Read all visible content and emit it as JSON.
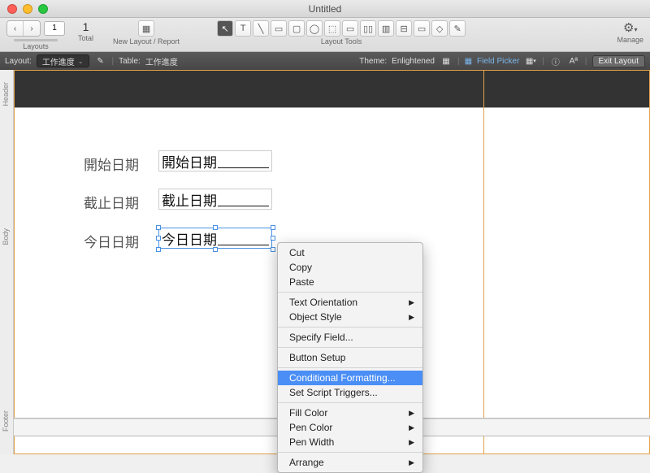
{
  "window": {
    "title": "Untitled"
  },
  "toolbar": {
    "page_current": "1",
    "total_count": "1",
    "total_label": "Total",
    "layouts_label": "Layouts",
    "newlayout_label": "New Layout / Report",
    "layouttools_label": "Layout Tools",
    "manage_label": "Manage"
  },
  "layoutbar": {
    "layout_label": "Layout:",
    "layout_value": "工作進度",
    "table_label": "Table:",
    "table_value": "工作進度",
    "theme_label": "Theme:",
    "theme_value": "Enlightened",
    "field_picker": "Field Picker",
    "exit": "Exit Layout"
  },
  "rulers": {
    "header": "Header",
    "body": "Body",
    "footer": "Footer"
  },
  "fields": {
    "row1_label": "開始日期",
    "row1_value": "開始日期",
    "row2_label": "截止日期",
    "row2_value": "截止日期",
    "row3_label": "今日日期",
    "row3_value": "今日日期"
  },
  "contextmenu": {
    "cut": "Cut",
    "copy": "Copy",
    "paste": "Paste",
    "text_orientation": "Text Orientation",
    "object_style": "Object Style",
    "specify_field": "Specify Field...",
    "button_setup": "Button Setup",
    "conditional_formatting": "Conditional Formatting...",
    "set_script_triggers": "Set Script Triggers...",
    "fill_color": "Fill Color",
    "pen_color": "Pen Color",
    "pen_width": "Pen Width",
    "arrange": "Arrange"
  }
}
